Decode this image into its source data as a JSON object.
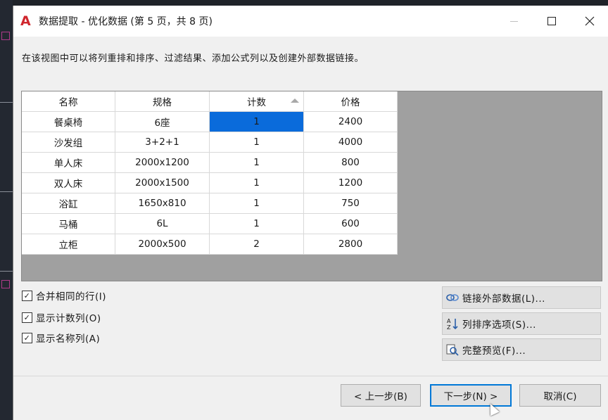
{
  "window": {
    "app_icon": "A",
    "title": "数据提取 - 优化数据 (第 5 页，共 8 页)",
    "controls": {
      "minimize": "—",
      "maximize": "□",
      "close": "✕"
    }
  },
  "description": "在该视图中可以将列重排和排序、过滤结果、添加公式列以及创建外部数据链接。",
  "table": {
    "columns": [
      "名称",
      "规格",
      "计数",
      "价格"
    ],
    "sort_column": "计数",
    "rows": [
      [
        "餐桌椅",
        "6座",
        "1",
        "2400"
      ],
      [
        "沙发组",
        "3+2+1",
        "1",
        "4000"
      ],
      [
        "单人床",
        "2000x1200",
        "1",
        "800"
      ],
      [
        "双人床",
        "2000x1500",
        "1",
        "1200"
      ],
      [
        "浴缸",
        "1650x810",
        "1",
        "750"
      ],
      [
        "马桶",
        "6L",
        "1",
        "600"
      ],
      [
        "立柜",
        "2000x500",
        "2",
        "2800"
      ]
    ],
    "selected_cell": "餐桌椅 / 计数"
  },
  "options": {
    "merge_rows": {
      "label": "合并相同的行(I)",
      "checked": true
    },
    "show_count": {
      "label": "显示计数列(O)",
      "checked": true
    },
    "show_name": {
      "label": "显示名称列(A)",
      "checked": true
    }
  },
  "side_buttons": {
    "link_external": {
      "label": "链接外部数据(L)...",
      "icon": "link-icon"
    },
    "sort_options": {
      "label": "列排序选项(S)...",
      "icon": "sort-icon"
    },
    "full_preview": {
      "label": "完整预览(F)...",
      "icon": "preview-icon"
    }
  },
  "nav": {
    "back": "< 上一步(B)",
    "next": "下一步(N) >",
    "cancel": "取消(C)"
  },
  "colors": {
    "selection": "#0a6bdb",
    "app_icon": "#d0262d",
    "dialog_bg": "#f0f0f0",
    "grid_bg": "#a0a0a0"
  }
}
